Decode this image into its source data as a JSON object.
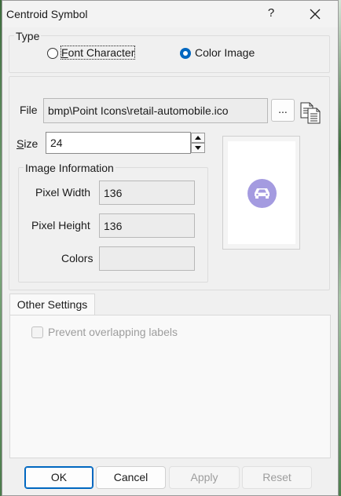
{
  "window": {
    "title": "Centroid Symbol",
    "help_glyph": "?"
  },
  "type_group": {
    "legend": "Type",
    "options": [
      {
        "label": "Font Character",
        "selected": false
      },
      {
        "label": "Color Image",
        "selected": true
      }
    ]
  },
  "file": {
    "label": "File",
    "value": "bmp\\Point Icons\\retail-automobile.ico",
    "browse_label": "..."
  },
  "size": {
    "label": "Size",
    "value": "24"
  },
  "image_info": {
    "legend": "Image Information",
    "pixel_width_label": "Pixel Width",
    "pixel_width": "136",
    "pixel_height_label": "Pixel Height",
    "pixel_height": "136",
    "colors_label": "Colors",
    "colors": ""
  },
  "preview": {
    "icon": "car-icon",
    "icon_color": "#a49be0"
  },
  "other_settings": {
    "tab_label": "Other Settings",
    "prevent_overlap_label": "Prevent overlapping labels",
    "prevent_overlap_checked": false,
    "prevent_overlap_enabled": false
  },
  "buttons": {
    "ok": "OK",
    "cancel": "Cancel",
    "apply": "Apply",
    "reset": "Reset"
  },
  "colors": {
    "accent": "#0067c0",
    "dialog_bg": "#f0f0f0"
  }
}
